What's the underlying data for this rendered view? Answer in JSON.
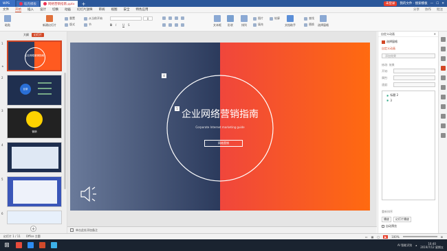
{
  "titlebar": {
    "app_tab": "WPS",
    "tabs": [
      "稻壳模板",
      "网络营销指南.pptx"
    ],
    "login_label": "未登录",
    "sync_label": "协作",
    "account_text": "我的文件 · 搜索模板"
  },
  "menubar": {
    "items": [
      "文件",
      "开始",
      "插入",
      "设计",
      "切换",
      "动画",
      "幻灯片放映",
      "审阅",
      "视图",
      "安全",
      "特色应用"
    ],
    "active_index": 1,
    "right_items": [
      "分享",
      "协作",
      "批注"
    ]
  },
  "ribbon": {
    "paste": "粘贴",
    "new_slide": "新建幻灯片",
    "reset": "重置",
    "layout": "版式",
    "from_current": "从当前开始",
    "section": "节",
    "font_size": "0",
    "text_box": "文本框",
    "shape": "形状",
    "arrange": "排列",
    "picture": "图片",
    "fill": "填充",
    "outline": "轮廓",
    "find": "查找",
    "replace": "替换",
    "text_tools": "文档助手",
    "select": "选择窗格"
  },
  "left_panel": {
    "tabs": [
      "大纲",
      "幻灯片"
    ],
    "active_tab": 1,
    "thumbs": [
      {
        "num": "1",
        "text": "企业网络营销指南"
      },
      {
        "num": "2",
        "text": "目录"
      },
      {
        "num": "3",
        "text": "营销"
      },
      {
        "num": "4",
        "text": ""
      },
      {
        "num": "5",
        "text": ""
      },
      {
        "num": "6",
        "text": ""
      }
    ]
  },
  "slide": {
    "title": "企业网络营销指南",
    "subtitle": "Corporate Internet marketing guide",
    "button": "网络营销",
    "marker_a": "4",
    "marker_b": "5"
  },
  "notes": {
    "placeholder": "单击此处添加备注"
  },
  "right_panel": {
    "title": "自定义动画",
    "select_pane": "选择窗格",
    "section_label": "自定义动画",
    "add_effect": "添加效果",
    "modify_label": "修改: 效果",
    "start_label": "开始:",
    "property_label": "属性:",
    "speed_label": "速度:",
    "list_items": [
      "标题 2",
      "3"
    ],
    "reorder_label": "重新排序",
    "play_label": "播放",
    "slideshow_label": "幻灯片播放",
    "autopreview_label": "自动预览"
  },
  "statusbar": {
    "slide_info": "幻灯片 1 / 11",
    "theme": "Office 主题",
    "zoom": "100%"
  },
  "taskbar": {
    "tray_text": "AI 智能识别",
    "time": "16:40",
    "date": "2019/7/12 星期五"
  },
  "colors": {
    "accent": "#d24726",
    "titlebar": "#2b579a",
    "slide_left_dark": "#2b3a5c",
    "slide_right": "#ff6a10"
  },
  "icons": [
    "search-icon",
    "speaker-icon",
    "plus-icon",
    "close-icon",
    "minimize-icon",
    "maximize-icon"
  ]
}
